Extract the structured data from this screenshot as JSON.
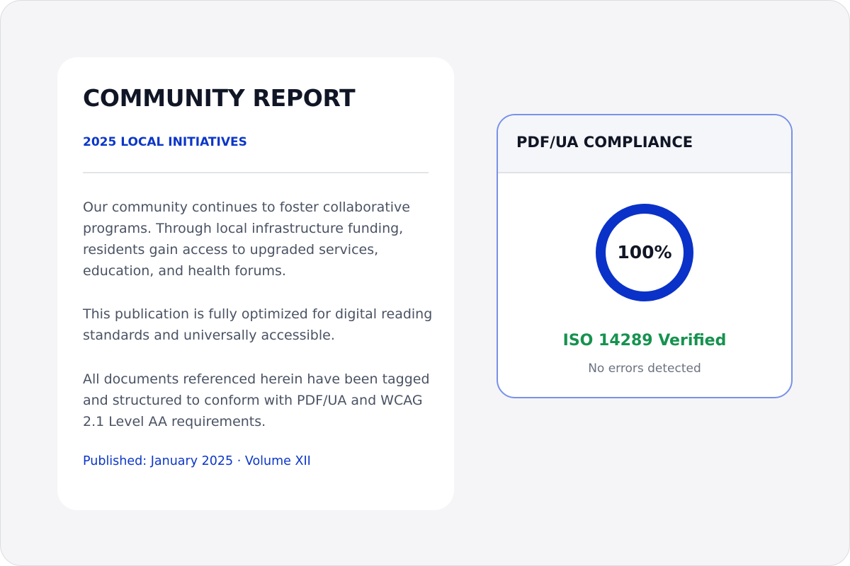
{
  "report": {
    "title": "COMMUNITY REPORT",
    "subtitle": "2025 LOCAL INITIATIVES",
    "paragraphs": [
      "Our community continues to foster collaborative programs. Through local infrastructure funding, residents gain access to upgraded services, education, and health forums.",
      "This publication is fully optimized for digital reading standards and universally accessible.",
      "All documents referenced herein have been tagged and structured to conform with PDF/UA and WCAG 2.1 Level AA requirements."
    ],
    "footer": "Published: January 2025 · Volume XII"
  },
  "compliance": {
    "title": "PDF/UA COMPLIANCE",
    "score_label": "100%",
    "score_fraction": 1.0,
    "verified_text": "ISO 14289 Verified",
    "status_text": "No errors detected"
  },
  "colors": {
    "accent_blue": "#0b36c9",
    "ring_blue": "#0a32c8",
    "success_green": "#16924f",
    "card_border": "#7891e8"
  }
}
